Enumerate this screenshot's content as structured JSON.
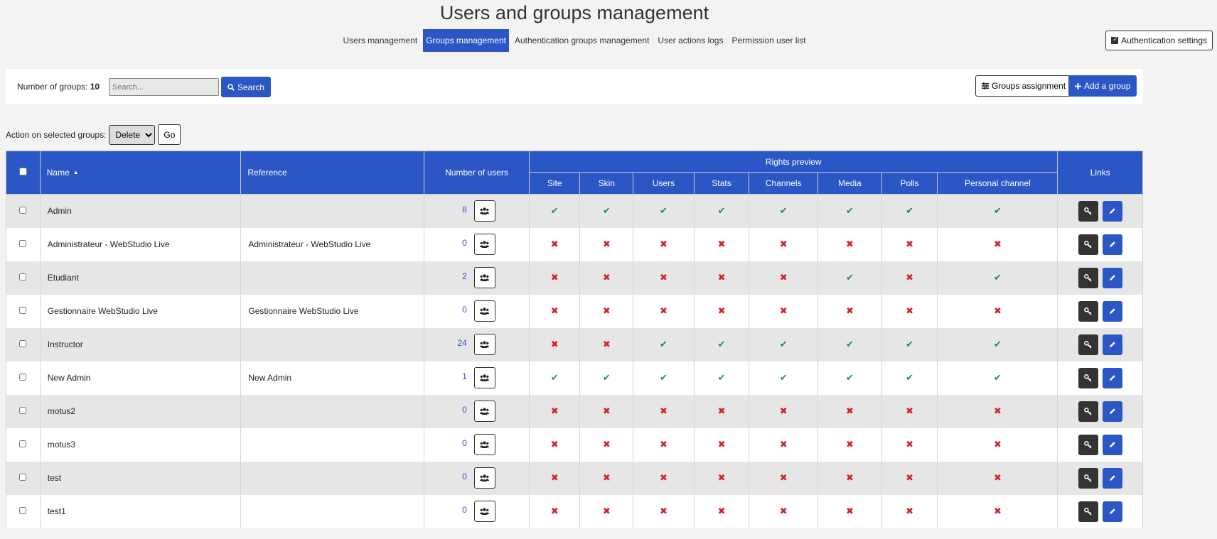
{
  "page": {
    "title": "Users and groups management"
  },
  "nav": {
    "tabs": [
      {
        "label": "Users management",
        "active": false
      },
      {
        "label": "Groups management",
        "active": true
      },
      {
        "label": "Authentication groups management",
        "active": false
      },
      {
        "label": "User actions logs",
        "active": false
      },
      {
        "label": "Permission user list",
        "active": false
      }
    ],
    "auth_settings_label": "Authentication settings"
  },
  "toolbar": {
    "count_label": "Number of groups:",
    "count_value": "10",
    "search_placeholder": "Search...",
    "search_label": "Search",
    "assign_label": "Groups assignment",
    "add_label": "Add a group"
  },
  "actions": {
    "label": "Action on selected groups:",
    "selected": "Delete",
    "go_label": "Go"
  },
  "table": {
    "headers": {
      "name": "Name",
      "reference": "Reference",
      "number_of_users": "Number of users",
      "rights_preview": "Rights preview",
      "links": "Links",
      "rights": [
        "Site",
        "Skin",
        "Users",
        "Stats",
        "Channels",
        "Media",
        "Polls",
        "Personal channel"
      ]
    },
    "rows": [
      {
        "name": "Admin",
        "reference": "",
        "users": "8",
        "rights": [
          true,
          true,
          true,
          true,
          true,
          true,
          true,
          true
        ]
      },
      {
        "name": "Administrateur - WebStudio Live",
        "reference": "Administrateur - WebStudio Live",
        "users": "0",
        "rights": [
          false,
          false,
          false,
          false,
          false,
          false,
          false,
          false
        ]
      },
      {
        "name": "Etudiant",
        "reference": "",
        "users": "2",
        "rights": [
          false,
          false,
          false,
          false,
          false,
          true,
          false,
          true
        ]
      },
      {
        "name": "Gestionnaire WebStudio Live",
        "reference": "Gestionnaire WebStudio Live",
        "users": "0",
        "rights": [
          false,
          false,
          false,
          false,
          false,
          false,
          false,
          false
        ]
      },
      {
        "name": "Instructor",
        "reference": "",
        "users": "24",
        "rights": [
          false,
          false,
          true,
          true,
          true,
          true,
          true,
          true
        ]
      },
      {
        "name": "New Admin",
        "reference": "New Admin",
        "users": "1",
        "rights": [
          true,
          true,
          true,
          true,
          true,
          true,
          true,
          true
        ]
      },
      {
        "name": "motus2",
        "reference": "",
        "users": "0",
        "rights": [
          false,
          false,
          false,
          false,
          false,
          false,
          false,
          false
        ]
      },
      {
        "name": "motus3",
        "reference": "",
        "users": "0",
        "rights": [
          false,
          false,
          false,
          false,
          false,
          false,
          false,
          false
        ]
      },
      {
        "name": "test",
        "reference": "",
        "users": "0",
        "rights": [
          false,
          false,
          false,
          false,
          false,
          false,
          false,
          false
        ]
      },
      {
        "name": "test1",
        "reference": "",
        "users": "0",
        "rights": [
          false,
          false,
          false,
          false,
          false,
          false,
          false,
          false
        ]
      }
    ]
  },
  "colors": {
    "accent": "#2a56c6",
    "ok": "#1e8a53",
    "no": "#d3242c",
    "dark": "#333333"
  },
  "icons": {
    "search": "search-icon",
    "assign": "sliders-icon",
    "add": "plus-icon",
    "users": "users-icon",
    "key": "key-icon",
    "edit": "pencil-icon",
    "sort": "sort-asc-icon",
    "check": "check-icon",
    "cross": "cross-icon"
  }
}
